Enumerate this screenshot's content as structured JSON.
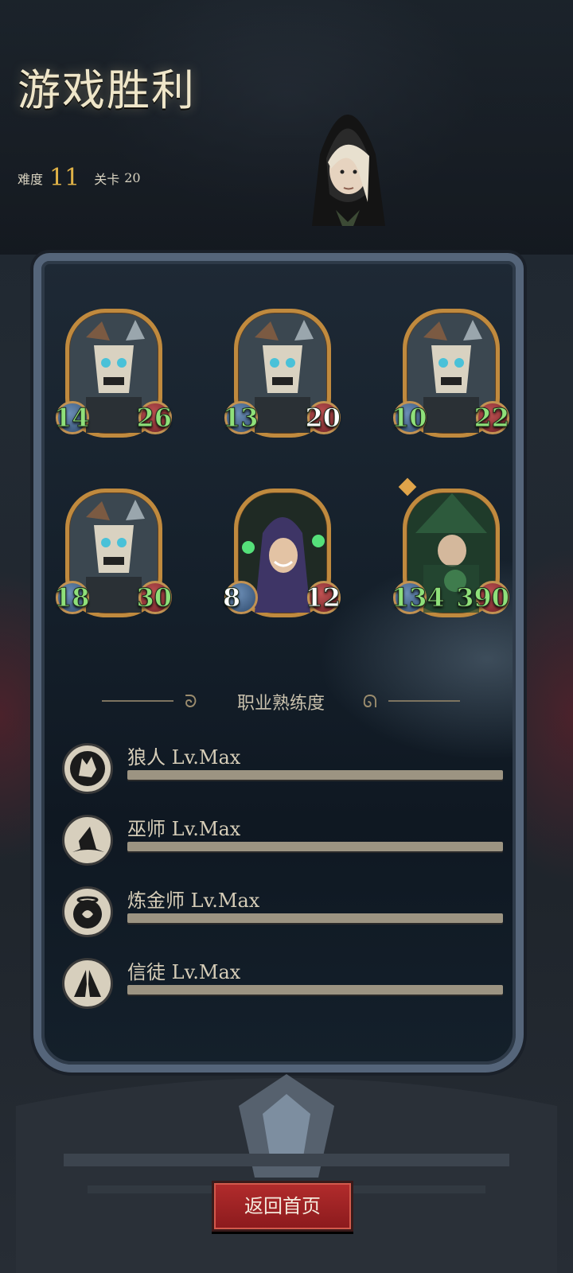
{
  "header": {
    "title": "游戏胜利",
    "difficulty_label": "难度",
    "difficulty_value": "11",
    "stage_label": "关卡",
    "stage_value": "20"
  },
  "cards": [
    {
      "left": "14",
      "right": "26",
      "left_color": "green",
      "right_color": "green",
      "portrait": "minotaur-icon"
    },
    {
      "left": "13",
      "right": "20",
      "left_color": "green",
      "right_color": "white",
      "portrait": "minotaur-icon"
    },
    {
      "left": "10",
      "right": "22",
      "left_color": "green",
      "right_color": "green",
      "portrait": "minotaur-icon"
    },
    {
      "left": "18",
      "right": "30",
      "left_color": "green",
      "right_color": "green",
      "portrait": "minotaur-icon"
    },
    {
      "left": "8",
      "right": "12",
      "left_color": "white",
      "right_color": "white",
      "portrait": "hooded-mage-icon"
    },
    {
      "left": "134",
      "right": "390",
      "left_color": "green",
      "right_color": "green",
      "portrait": "witch-icon"
    }
  ],
  "mastery": {
    "title": "职业熟练度",
    "items": [
      {
        "name": "狼人 Lv.Max",
        "icon": "wolf-icon",
        "progress": 1.0
      },
      {
        "name": "巫师 Lv.Max",
        "icon": "wizard-hat-icon",
        "progress": 1.0
      },
      {
        "name": "炼金师 Lv.Max",
        "icon": "cauldron-icon",
        "progress": 1.0
      },
      {
        "name": "信徒 Lv.Max",
        "icon": "praying-hands-icon",
        "progress": 1.0
      }
    ]
  },
  "footer": {
    "home_button": "返回首页"
  },
  "colors": {
    "stat_green": "#8fe07a",
    "stat_white": "#ffffff",
    "difficulty_gold": "#e0b247",
    "button_red": "#a82526"
  }
}
